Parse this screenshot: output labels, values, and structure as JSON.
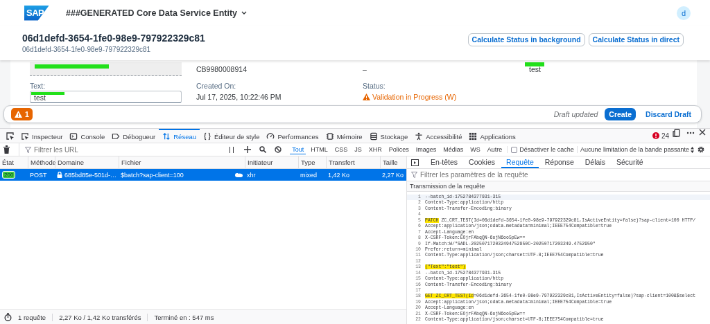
{
  "shell": {
    "logo": "SAP",
    "title": "###GENERATED Core Data Service Entity",
    "avatar": "d"
  },
  "header": {
    "title": "06d1defd-3654-1fe0-98e9-797922329c81",
    "subtitle": "06d1defd-3654-1fe0-98e9-797922329c81",
    "actions": [
      "Calculate Status in background",
      "Calculate Status in direct"
    ]
  },
  "form": {
    "rows": [
      [
        {
          "kind": "readonly",
          "redacted": true
        },
        {
          "kind": "text",
          "value": "CB9980008914",
          "redacted": false
        },
        {
          "kind": "text",
          "value": "–",
          "redacted": false
        },
        {
          "kind": "text",
          "value": "test",
          "redacted": true
        }
      ],
      [
        {
          "kind": "input",
          "label": "Text:",
          "value": "test",
          "redacted": true
        },
        {
          "kind": "text",
          "label": "Created On:",
          "value": "Jul 17, 2025, 10:22:46 PM",
          "redacted": false
        },
        {
          "kind": "status",
          "label": "Status:",
          "value": "Validation in Progress (W)",
          "redacted": false
        }
      ]
    ]
  },
  "footer": {
    "message_count": "1",
    "status": "Draft updated",
    "actions": [
      {
        "label": "Create",
        "kind": "emphasized"
      },
      {
        "label": "Discard Draft",
        "kind": "transparent"
      }
    ]
  },
  "devtools": {
    "tabs": [
      {
        "label": "Inspecteur",
        "selected": false
      },
      {
        "label": "Console",
        "selected": false
      },
      {
        "label": "Débogueur",
        "selected": false
      },
      {
        "label": "Réseau",
        "selected": true
      },
      {
        "label": "Éditeur de style",
        "selected": false
      },
      {
        "label": "Performances",
        "selected": false
      },
      {
        "label": "Mémoire",
        "selected": false
      },
      {
        "label": "Stockage",
        "selected": false
      },
      {
        "label": "Accessibilité",
        "selected": false
      },
      {
        "label": "Applications",
        "selected": false
      }
    ],
    "error_count": "24",
    "toolbar": {
      "filter_placeholder": "Filtrer les URL",
      "type_filters": [
        {
          "label": "Tout",
          "selected": true
        },
        {
          "label": "HTML",
          "selected": false
        },
        {
          "label": "CSS",
          "selected": false
        },
        {
          "label": "JS",
          "selected": false
        },
        {
          "label": "XHR",
          "selected": false
        },
        {
          "label": "Polices",
          "selected": false
        },
        {
          "label": "Images",
          "selected": false
        },
        {
          "label": "Médias",
          "selected": false
        },
        {
          "label": "WS",
          "selected": false
        },
        {
          "label": "Autre",
          "selected": false
        }
      ],
      "disable_cache": {
        "label": "Désactiver le cache",
        "checked": false
      },
      "throttling": "Aucune limitation de la bande passante"
    },
    "table": {
      "columns": [
        "État",
        "Méthode",
        "Domaine",
        "Fichier",
        "Initiateur",
        "Type",
        "Transfert",
        "Taille"
      ],
      "rows": [
        {
          "status": "200",
          "method": "POST",
          "domain": "685bd85e-501d-…",
          "file": "$batch?sap-client=100",
          "initiator": "xhr",
          "type": "mixed",
          "transferred": "1,42 Ko",
          "size": "2,27 Ko",
          "selected": true
        }
      ]
    },
    "details": {
      "tabs": [
        {
          "label": "En-têtes",
          "selected": false
        },
        {
          "label": "Cookies",
          "selected": false
        },
        {
          "label": "Requête",
          "selected": true
        },
        {
          "label": "Réponse",
          "selected": false
        },
        {
          "label": "Délais",
          "selected": false
        },
        {
          "label": "Sécurité",
          "selected": false
        }
      ],
      "filter_placeholder": "Filtrer les paramètres de la requête",
      "section": "Transmission de la requête",
      "lines": [
        {
          "number": "1",
          "text": "--batch_id-1752784377931-315"
        },
        {
          "number": "2",
          "text": "Content-Type:application/http"
        },
        {
          "number": "3",
          "text": "Content-Transfer-Encoding:binary"
        },
        {
          "number": "4"
        },
        {
          "number": "5",
          "highlight": "PATCH",
          "text": " ZC_CRT_TEST(Id=06d1defd-3654-1fe0-98e9-797922329c81,IsActiveEntity=false)?sap-client=100 HTTP/"
        },
        {
          "number": "6",
          "text": "Accept:application/json;odata.metadata=minimal;IEEE754Compatible=true"
        },
        {
          "number": "7",
          "text": "Accept-Language:en"
        },
        {
          "number": "8",
          "text": "X-CSRF-Token:EOjrFAbqQN-6ojN6oo5pEw=="
        },
        {
          "number": "9",
          "text": "If-Match:W/\"SADL-202507172032494752950C~20250717203249.4752950\""
        },
        {
          "number": "10",
          "text": "Prefer:return=minimal"
        },
        {
          "number": "11",
          "text": "Content-Type:application/json;charset=UTF-8;IEEE754Compatible=true"
        },
        {
          "number": "12"
        },
        {
          "number": "13",
          "highlight": "{\"Text\":\"test\"}"
        },
        {
          "number": "14",
          "text": "--batch_id-1752784377931-315"
        },
        {
          "number": "15",
          "text": "Content-Type:application/http"
        },
        {
          "number": "16",
          "text": "Content-Transfer-Encoding:binary"
        },
        {
          "number": "17"
        },
        {
          "number": "18",
          "highlight": "GET ZC_CRT_TEST(Id",
          "text": "=06d1defd-3654-1fe0-98e9-797922329c81,IsActiveEntity=false)?sap-client=100&$select"
        },
        {
          "number": "19",
          "text": "Accept:application/json;odata.metadata=minimal;IEEE754Compatible=true"
        },
        {
          "number": "20",
          "text": "Accept-Language:en"
        },
        {
          "number": "21",
          "text": "X-CSRF-Token:EOjrFAbqQN-6ojN6oo5pEw=="
        },
        {
          "number": "22",
          "text": "Content-Type:application/json;charset=UTF-8;IEEE754Compatible=true"
        }
      ]
    },
    "status_bar": [
      "1 requête",
      "2,27 Ko / 1,42 Ko transférés",
      "Terminé en : 547 ms"
    ]
  }
}
